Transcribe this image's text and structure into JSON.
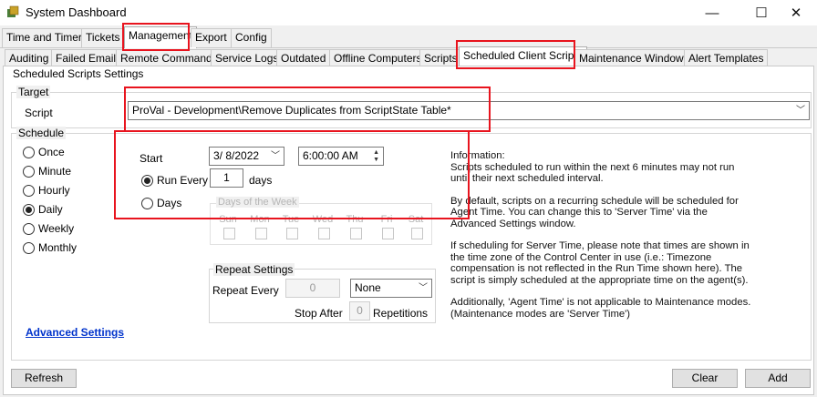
{
  "window": {
    "title": "System Dashboard",
    "min": "—",
    "max": "☐",
    "close": "✕"
  },
  "main_tabs": [
    "Time and Timers",
    "Tickets",
    "Management",
    "Export",
    "Config"
  ],
  "sub_tabs": [
    "Auditing",
    "Failed Emails",
    "Remote Commands",
    "Service Logs",
    "Outdated",
    "Offline Computers",
    "Scripts",
    "Scheduled Client Scripts",
    "Maintenance Windows",
    "Alert Templates"
  ],
  "panel_title": "Scheduled Scripts Settings",
  "target": {
    "label": "Target",
    "script_label": "Script",
    "script_value": "ProVal - Development\\Remove Duplicates from ScriptState Table*"
  },
  "schedule": {
    "label": "Schedule",
    "options": [
      "Once",
      "Minute",
      "Hourly",
      "Daily",
      "Weekly",
      "Monthly"
    ],
    "selected": "Daily",
    "start_label": "Start",
    "start_date": "3/  8/2022",
    "start_time": "6:00:00 AM",
    "run_every_label": "Run Every",
    "run_every_value": "1",
    "days_unit": "days",
    "days_label": "Days",
    "dow_label": "Days of the Week",
    "dow": [
      "Sun",
      "Mon",
      "Tue",
      "Wed",
      "Thu",
      "Fri",
      "Sat"
    ],
    "repeat": {
      "label": "Repeat Settings",
      "every_label": "Repeat Every",
      "every_value": "0",
      "unit_value": "None",
      "stop_after_label": "Stop After",
      "stop_after_value": "0",
      "repetitions_label": "Repetitions"
    }
  },
  "information": [
    "Information:\nScripts scheduled to run within the next 6 minutes may not run until their next scheduled interval.",
    "By default, scripts on a recurring schedule will be scheduled for Agent Time. You can change this to 'Server Time' via the Advanced Settings window.",
    "If scheduling for Server Time, please note that times are shown in the time zone of the Control Center in use (i.e.: Timezone compensation is not reflected in the Run Time shown here). The script is simply scheduled at the appropriate time on the agent(s).",
    "Additionally, 'Agent Time' is not applicable to Maintenance modes. (Maintenance modes are 'Server Time')"
  ],
  "advanced_link": "Advanced Settings",
  "buttons": {
    "refresh": "Refresh",
    "clear": "Clear",
    "add": "Add"
  }
}
